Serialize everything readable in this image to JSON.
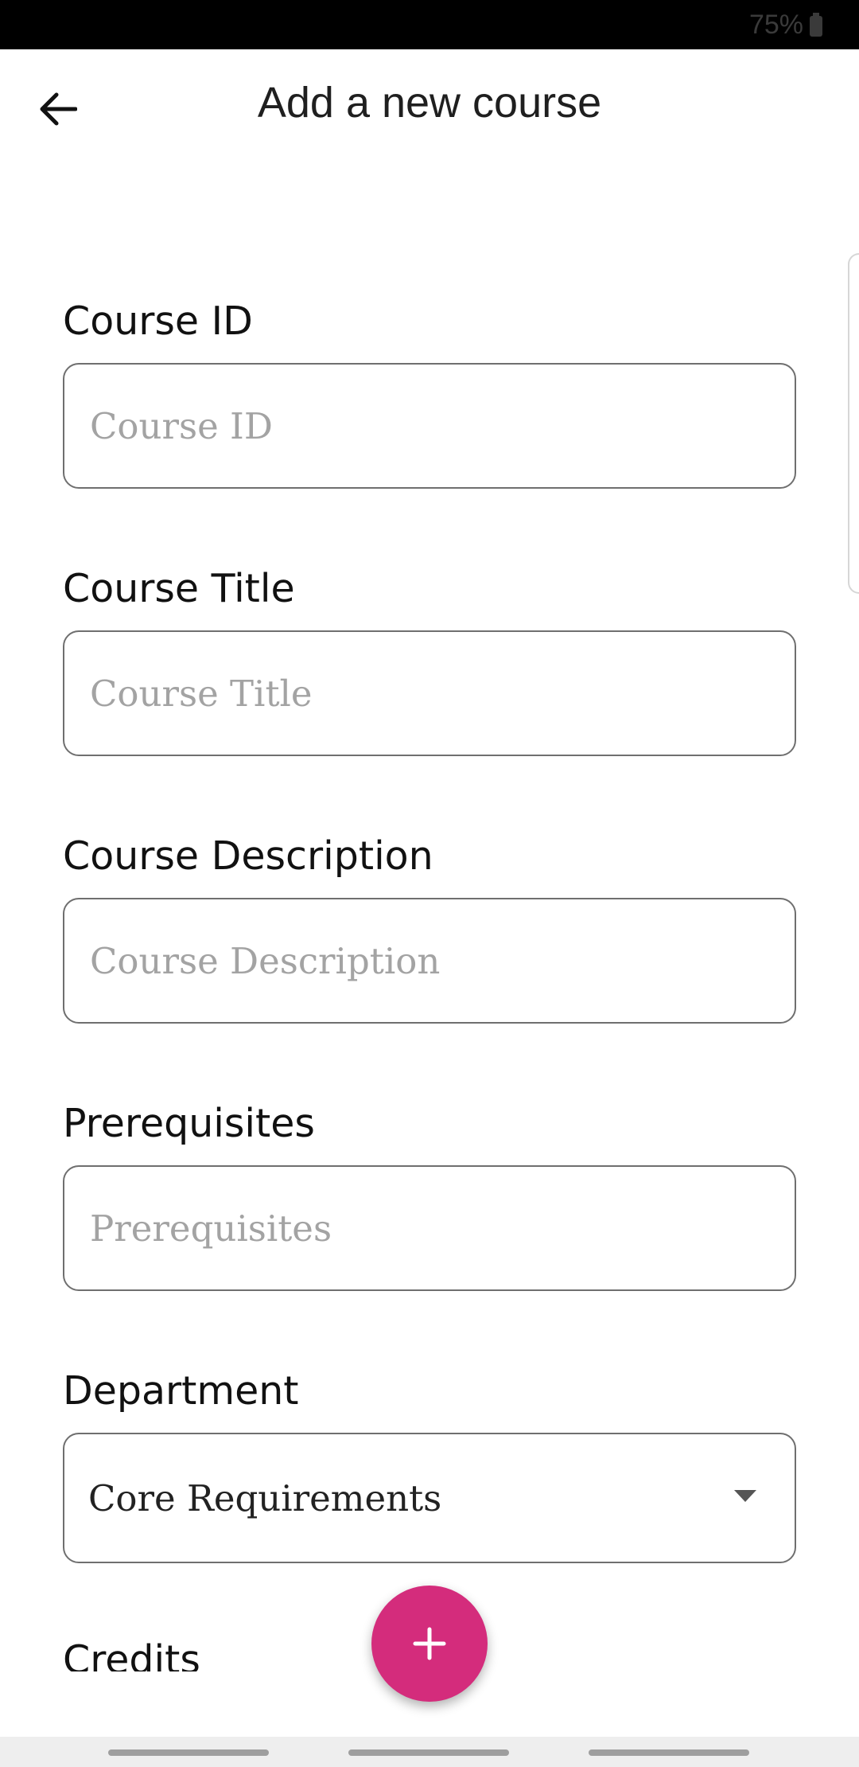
{
  "status_bar": {
    "battery": "75%"
  },
  "app_bar": {
    "title": "Add a new course"
  },
  "form": {
    "course_id": {
      "label": "Course ID",
      "placeholder": "Course ID"
    },
    "course_title": {
      "label": "Course Title",
      "placeholder": "Course Title"
    },
    "course_description": {
      "label": "Course Description",
      "placeholder": "Course Description"
    },
    "prerequisites": {
      "label": "Prerequisites",
      "placeholder": "Prerequisites"
    },
    "department": {
      "label": "Department",
      "value": "Core Requirements"
    },
    "credits": {
      "label": "Credits"
    }
  },
  "fab": {
    "icon": "plus-icon",
    "color": "#d42c7c"
  },
  "colors": {
    "fab": "#d42c7c",
    "status_bar": "#000000",
    "nav_bar": "#eeeeee"
  }
}
